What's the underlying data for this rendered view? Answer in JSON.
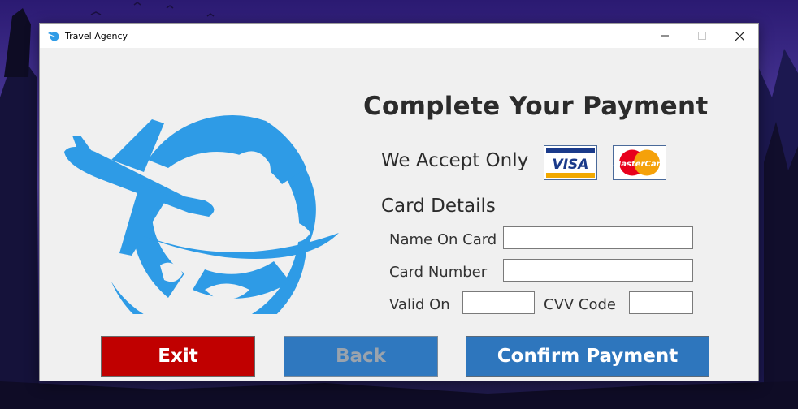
{
  "window": {
    "title": "Travel Agency"
  },
  "heading": "Complete Your Payment",
  "accept_label": "We Accept Only",
  "cards": [
    {
      "name": "VISA",
      "icon": "visa-card-icon"
    },
    {
      "name": "MasterCard",
      "icon": "mastercard-card-icon"
    }
  ],
  "section_title": "Card Details",
  "form": {
    "name_label": "Name On Card",
    "name_value": "",
    "number_label": "Card Number",
    "number_value": "",
    "valid_label": "Valid On",
    "valid_value": "",
    "cvv_label": "CVV Code",
    "cvv_value": ""
  },
  "buttons": {
    "exit": "Exit",
    "back": "Back",
    "confirm": "Confirm Payment"
  },
  "colors": {
    "logo_blue": "#2e9be6",
    "exit_red": "#c00000",
    "button_blue": "#2e76bd"
  }
}
